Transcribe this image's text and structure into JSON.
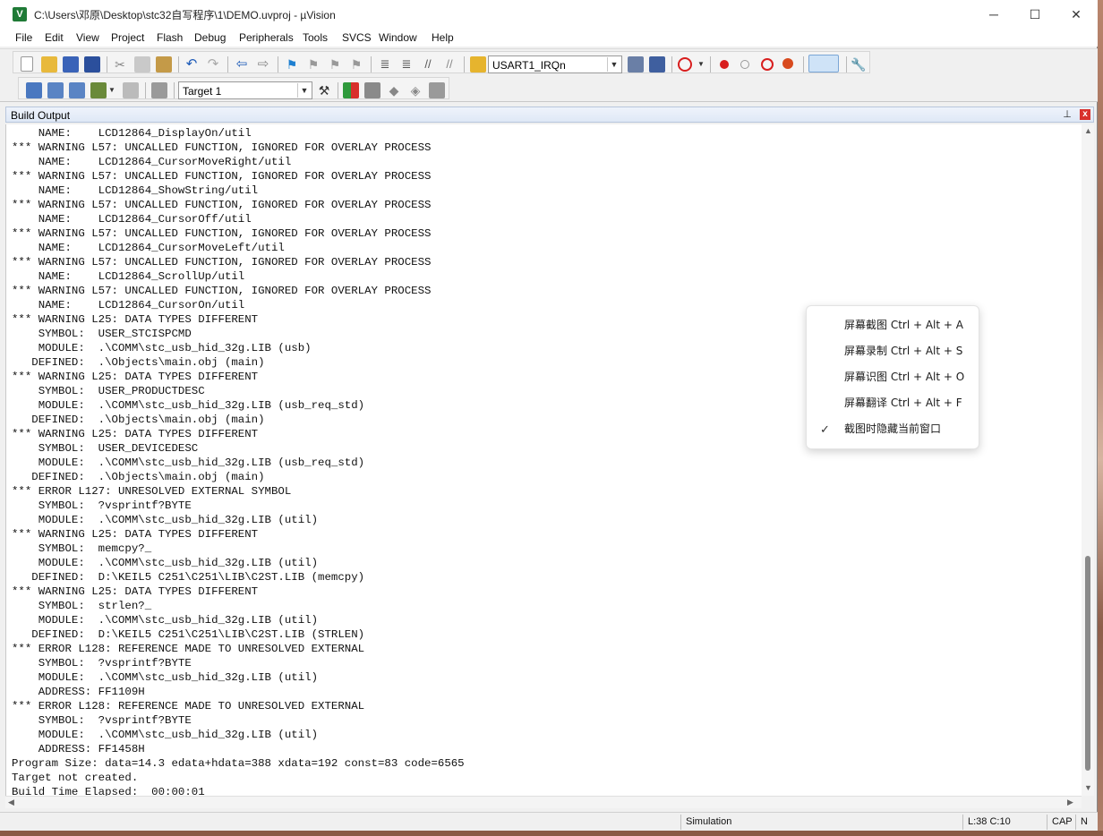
{
  "window": {
    "title": "C:\\Users\\邓原\\Desktop\\stc32自写程序\\1\\DEMO.uvproj - µVision",
    "app_icon_letter": "V",
    "minimize": "─",
    "maximize": "☐",
    "close": "✕"
  },
  "menu": [
    "File",
    "Edit",
    "View",
    "Project",
    "Flash",
    "Debug",
    "Peripherals",
    "Tools",
    "SVCS",
    "Window",
    "Help"
  ],
  "toolbar": {
    "function_combo": "USART1_IRQn",
    "target_combo": "Target 1",
    "icons_row1": [
      "new-file-icon",
      "open-icon",
      "save-icon",
      "save-all-icon",
      "cut-icon",
      "copy-icon",
      "paste-icon",
      "undo-icon",
      "redo-icon",
      "nav-back-icon",
      "nav-forward-icon",
      "bookmark-icon",
      "prev-bookmark-icon",
      "next-bookmark-icon",
      "clear-bookmarks-icon",
      "indent-icon",
      "unindent-icon",
      "comment-icon",
      "uncomment-icon",
      "find-in-files-icon",
      "find-icon",
      "debug-session-icon",
      "breakpoint-icon",
      "disable-breakpoint-icon",
      "disable-all-breakpoints-icon",
      "kill-breakpoints-icon",
      "window-layout-icon",
      "configure-icon"
    ],
    "icons_row2": [
      "translate-icon",
      "build-icon",
      "rebuild-icon",
      "batch-build-icon",
      "stop-build-icon",
      "download-icon",
      "target-options-icon",
      "manage-components-icon",
      "pack-installer-icon",
      "select-pack-icon",
      "file-extensions-icon",
      "event-recorder-icon"
    ],
    "colors": {
      "breakpoint": "#d81e1e",
      "accent_blue": "#1e5bb8"
    }
  },
  "panel": {
    "title": "Build Output",
    "pin": "📌",
    "close": "x"
  },
  "output_lines": [
    "    NAME:    LCD12864_DisplayOn/util",
    "*** WARNING L57: UNCALLED FUNCTION, IGNORED FOR OVERLAY PROCESS",
    "    NAME:    LCD12864_CursorMoveRight/util",
    "*** WARNING L57: UNCALLED FUNCTION, IGNORED FOR OVERLAY PROCESS",
    "    NAME:    LCD12864_ShowString/util",
    "*** WARNING L57: UNCALLED FUNCTION, IGNORED FOR OVERLAY PROCESS",
    "    NAME:    LCD12864_CursorOff/util",
    "*** WARNING L57: UNCALLED FUNCTION, IGNORED FOR OVERLAY PROCESS",
    "    NAME:    LCD12864_CursorMoveLeft/util",
    "*** WARNING L57: UNCALLED FUNCTION, IGNORED FOR OVERLAY PROCESS",
    "    NAME:    LCD12864_ScrollUp/util",
    "*** WARNING L57: UNCALLED FUNCTION, IGNORED FOR OVERLAY PROCESS",
    "    NAME:    LCD12864_CursorOn/util",
    "*** WARNING L25: DATA TYPES DIFFERENT",
    "    SYMBOL:  USER_STCISPCMD",
    "    MODULE:  .\\COMM\\stc_usb_hid_32g.LIB (usb)",
    "   DEFINED:  .\\Objects\\main.obj (main)",
    "*** WARNING L25: DATA TYPES DIFFERENT",
    "    SYMBOL:  USER_PRODUCTDESC",
    "    MODULE:  .\\COMM\\stc_usb_hid_32g.LIB (usb_req_std)",
    "   DEFINED:  .\\Objects\\main.obj (main)",
    "*** WARNING L25: DATA TYPES DIFFERENT",
    "    SYMBOL:  USER_DEVICEDESC",
    "    MODULE:  .\\COMM\\stc_usb_hid_32g.LIB (usb_req_std)",
    "   DEFINED:  .\\Objects\\main.obj (main)",
    "*** ERROR L127: UNRESOLVED EXTERNAL SYMBOL",
    "    SYMBOL:  ?vsprintf?BYTE",
    "    MODULE:  .\\COMM\\stc_usb_hid_32g.LIB (util)",
    "*** WARNING L25: DATA TYPES DIFFERENT",
    "    SYMBOL:  memcpy?_",
    "    MODULE:  .\\COMM\\stc_usb_hid_32g.LIB (util)",
    "   DEFINED:  D:\\KEIL5 C251\\C251\\LIB\\C2ST.LIB (memcpy)",
    "*** WARNING L25: DATA TYPES DIFFERENT",
    "    SYMBOL:  strlen?_",
    "    MODULE:  .\\COMM\\stc_usb_hid_32g.LIB (util)",
    "   DEFINED:  D:\\KEIL5 C251\\C251\\LIB\\C2ST.LIB (STRLEN)",
    "*** ERROR L128: REFERENCE MADE TO UNRESOLVED EXTERNAL",
    "    SYMBOL:  ?vsprintf?BYTE",
    "    MODULE:  .\\COMM\\stc_usb_hid_32g.LIB (util)",
    "    ADDRESS: FF1109H",
    "*** ERROR L128: REFERENCE MADE TO UNRESOLVED EXTERNAL",
    "    SYMBOL:  ?vsprintf?BYTE",
    "    MODULE:  .\\COMM\\stc_usb_hid_32g.LIB (util)",
    "    ADDRESS: FF1458H",
    "Program Size: data=14.3 edata+hdata=388 xdata=192 const=83 code=6565",
    "Target not created.",
    "Build Time Elapsed:  00:00:01"
  ],
  "popup": {
    "items": [
      {
        "label": "屏幕截图 Ctrl + Alt + A",
        "checked": false
      },
      {
        "label": "屏幕录制 Ctrl + Alt + S",
        "checked": false
      },
      {
        "label": "屏幕识图 Ctrl + Alt + O",
        "checked": false
      },
      {
        "label": "屏幕翻译 Ctrl + Alt + F",
        "checked": false
      },
      {
        "label": "截图时隐藏当前窗口",
        "checked": true
      }
    ],
    "check": "✓"
  },
  "status": {
    "mode": "Simulation",
    "position": "L:38 C:10",
    "caps": "CAP",
    "num": "N"
  }
}
